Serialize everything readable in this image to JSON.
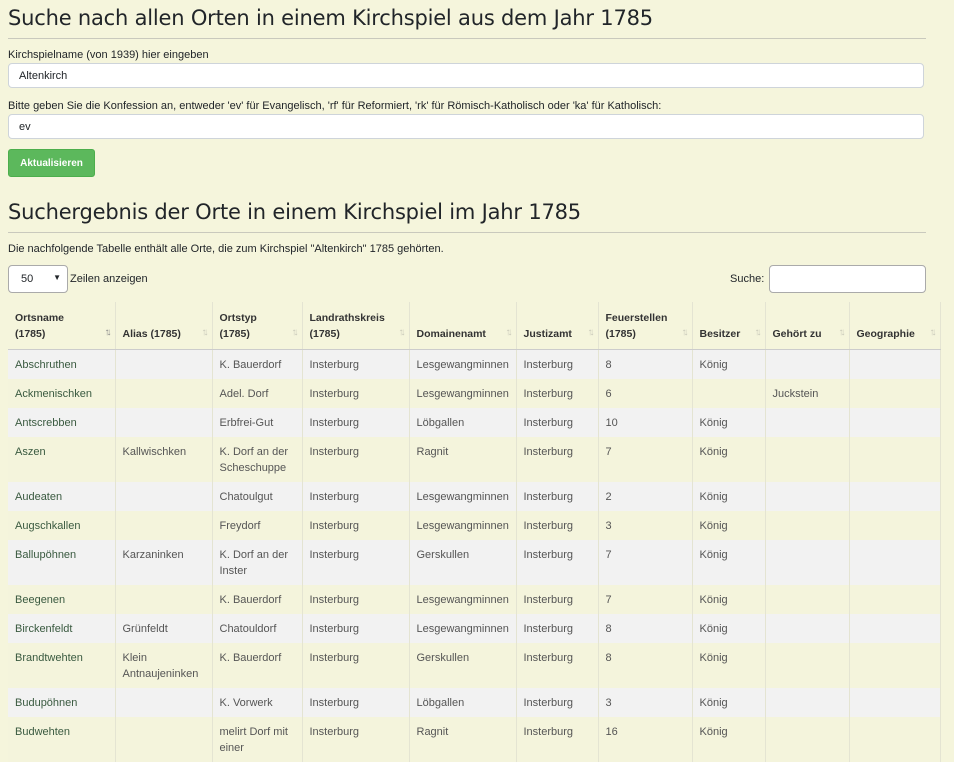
{
  "page_title": "Suche nach allen Orten in einem Kirchspiel aus dem Jahr 1785",
  "form": {
    "kirchspiel_label": "Kirchspielname (von 1939) hier eingeben",
    "kirchspiel_value": "Altenkirch",
    "konfession_label": "Bitte geben Sie die Konfession an, entweder 'ev' für Evangelisch, 'rf' für Reformiert, 'rk' für Römisch-Katholisch oder 'ka' für Katholisch:",
    "konfession_value": "ev",
    "submit_label": "Aktualisieren"
  },
  "results": {
    "heading": "Suchergebnis der Orte in einem Kirchspiel im Jahr 1785",
    "intro": "Die nachfolgende Tabelle enthält alle Orte, die zum Kirchspiel \"Altenkirch\" 1785 gehörten.",
    "page_length": "50",
    "page_length_suffix": "Zeilen anzeigen",
    "search_label": "Suche:",
    "search_value": ""
  },
  "table": {
    "columns": [
      "Ortsname\n(1785)",
      "Alias (1785)",
      "Ortstyp\n(1785)",
      "Landrathskreis\n(1785)",
      "Domainenamt",
      "Justizamt",
      "Feuerstellen\n(1785)",
      "Besitzer",
      "Gehört zu",
      "Geographie"
    ],
    "rows": [
      [
        "Abschruthen",
        "",
        "K. Bauerdorf",
        "Insterburg",
        "Lesgewangminnen",
        "Insterburg",
        "8",
        "König",
        "",
        ""
      ],
      [
        "Ackmenischken",
        "",
        "Adel. Dorf",
        "Insterburg",
        "Lesgewangminnen",
        "Insterburg",
        "6",
        "",
        "Juckstein",
        ""
      ],
      [
        "Antscrebben",
        "",
        "Erbfrei-Gut",
        "Insterburg",
        "Löbgallen",
        "Insterburg",
        "10",
        "König",
        "",
        ""
      ],
      [
        "Aszen",
        "Kallwischken",
        "K. Dorf an der Scheschuppe",
        "Insterburg",
        "Ragnit",
        "Insterburg",
        "7",
        "König",
        "",
        ""
      ],
      [
        "Audeaten",
        "",
        "Chatoulgut",
        "Insterburg",
        "Lesgewangminnen",
        "Insterburg",
        "2",
        "König",
        "",
        ""
      ],
      [
        "Augschkallen",
        "",
        "Freydorf",
        "Insterburg",
        "Lesgewangminnen",
        "Insterburg",
        "3",
        "König",
        "",
        ""
      ],
      [
        "Ballupöhnen",
        "Karzaninken",
        "K. Dorf an der Inster",
        "Insterburg",
        "Gerskullen",
        "Insterburg",
        "7",
        "König",
        "",
        ""
      ],
      [
        "Beegenen",
        "",
        "K. Bauerdorf",
        "Insterburg",
        "Lesgewangminnen",
        "Insterburg",
        "7",
        "König",
        "",
        ""
      ],
      [
        "Birckenfeldt",
        "Grünfeldt",
        "Chatouldorf",
        "Insterburg",
        "Lesgewangminnen",
        "Insterburg",
        "8",
        "König",
        "",
        ""
      ],
      [
        "Brandtwehten",
        "Klein Antnaujeninken",
        "K. Bauerdorf",
        "Insterburg",
        "Gerskullen",
        "Insterburg",
        "8",
        "König",
        "",
        ""
      ],
      [
        "Budupöhnen",
        "",
        "K. Vorwerk",
        "Insterburg",
        "Löbgallen",
        "Insterburg",
        "3",
        "König",
        "",
        ""
      ],
      [
        "Budwehten",
        "",
        "melirt Dorf mit einer",
        "Insterburg",
        "Ragnit",
        "Insterburg",
        "16",
        "König",
        "",
        ""
      ]
    ]
  },
  "icons": {
    "sort": "sort-arrows-icon",
    "sort_active": "sort-ascending-icon",
    "select_chevron": "chevron-down-icon"
  },
  "colors": {
    "background": "#f5f5dc",
    "button": "#5cb85c",
    "row_odd": "#f2f2f2",
    "row_even": "#f4f4dc"
  }
}
